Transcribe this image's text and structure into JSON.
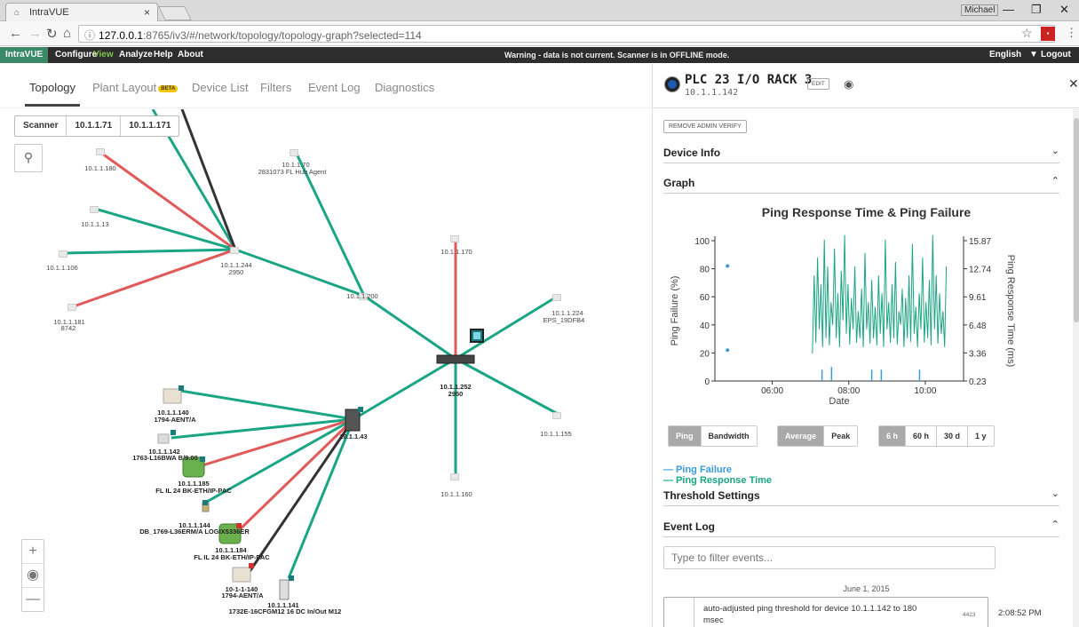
{
  "browser": {
    "tab_title": "IntraVUE",
    "url_host": "127.0.0.1",
    "url_rest": ":8765/iv3/#/network/topology/topology-graph?selected=114",
    "user": "Michael"
  },
  "appbar": {
    "brand": "IntraVUE",
    "menu": [
      "Configure",
      "View",
      "Analyze",
      "Help",
      "About"
    ],
    "warning": "Warning - data is not current. Scanner is in OFFLINE mode.",
    "language": "English",
    "logout": "Logout"
  },
  "tabs": {
    "topology": "Topology",
    "plant_layout": "Plant Layout",
    "beta": "BETA",
    "device_list": "Device List",
    "filters": "Filters",
    "event_log": "Event Log",
    "diagnostics": "Diagnostics"
  },
  "scanner": {
    "label": "Scanner",
    "ip1": "10.1.1.71",
    "ip2": "10.1.1.171"
  },
  "nodes": {
    "n180": "10.1.1.180",
    "n13": "10.1.1.13",
    "n106": "10.1.1.106",
    "n181a": "10.1.1.181",
    "n181b": "8742",
    "n244a": "10.1.1.244",
    "n244b": "2950",
    "n70a": "10.1.1.70",
    "n70b": "2831073 FL Hub Agent",
    "n200": "10.1.1.200",
    "n170": "10.1.1.170",
    "n224a": "10.1.1.224",
    "n224b": "EPS_19DFB4",
    "n252a": "10.1.1.252",
    "n252b": "2950",
    "n155": "10.1.1.155",
    "n160": "10.1.1.160",
    "n43": "10.1.1.43",
    "n140a": "10.1.1.140",
    "n140b": "1794-AENT/A",
    "n142a": "10.1.1.142",
    "n142b": "1763-L16BWA B/9.00",
    "n185a": "10.1.1.185",
    "n185b": "FL IL 24 BK-ETH/IP-PAC",
    "n144a": "10.1.1.144",
    "n144b": "DB_1769-L36ERM/A LOGIX5336ER",
    "n184a": "10.1.1.184",
    "n184b": "FL IL 24 BK-ETH/IP-PAC",
    "n1140a": "10-1-1-140",
    "n1140b": "1794-AENT/A",
    "n141a": "10.1.1.141",
    "n141b": "1732E-16CFGM12 16 DC In/Out M12"
  },
  "panel": {
    "title": "PLC 23 I/O RACK 3",
    "edit": "EDIT",
    "ip": "10.1.1.142",
    "remove_admin": "REMOVE ADMIN VERIFY",
    "device_info": "Device Info",
    "graph": "Graph",
    "threshold": "Threshold Settings",
    "event_log": "Event Log",
    "filter_placeholder": "Type to filter events...",
    "event_date": "June 1, 2015",
    "event_text": "auto-adjusted ping threshold for device 10.1.1.142 to 180 msec",
    "event_num": "4423",
    "event_time": "2:08:52 PM",
    "buttons": {
      "ping": "Ping",
      "bandwidth": "Bandwidth",
      "average": "Average",
      "peak": "Peak",
      "h6": "6 h",
      "h60": "60 h",
      "d30": "30 d",
      "y1": "1 y"
    },
    "legend_failure": "— Ping Failure",
    "legend_response": "— Ping Response Time"
  },
  "chart_data": {
    "type": "line",
    "title": "Ping Response Time & Ping Failure",
    "xlabel": "Date",
    "ylabel": "Ping Failure (%)",
    "y2label": "Ping Response Time (ms)",
    "x_ticks": [
      "06:00",
      "08:00",
      "10:00"
    ],
    "y_ticks": [
      0,
      20,
      40,
      60,
      80,
      100
    ],
    "y2_ticks": [
      0.23,
      3.36,
      6.48,
      9.61,
      12.74,
      15.87
    ],
    "ylim": [
      0,
      100
    ],
    "y2lim": [
      0.23,
      15.87
    ],
    "colors": {
      "failure": "#3a9ad9",
      "response": "#1aa584"
    },
    "series": [
      {
        "name": "Ping Failure",
        "points": [
          [
            4.83,
            82
          ],
          [
            4.83,
            22
          ]
        ],
        "spikes": [
          [
            7.3,
            8
          ],
          [
            7.55,
            10
          ],
          [
            8.6,
            8
          ],
          [
            8.85,
            8
          ],
          [
            9.85,
            8
          ]
        ]
      },
      {
        "name": "Ping Response Time",
        "x_start": 7.05,
        "x_end": 10.55,
        "values": [
          3.3,
          12,
          4.5,
          14,
          6,
          11,
          4,
          16,
          5,
          13,
          4.2,
          9,
          6.5,
          15,
          5,
          10,
          4,
          12.5,
          7,
          16.5,
          5.5,
          11,
          4.3,
          9.5,
          6,
          13,
          4.5,
          8,
          5,
          10.5,
          4,
          14.5,
          6,
          9,
          4.4,
          11.5,
          5,
          8.5,
          4.2,
          12,
          5.5,
          10,
          4,
          16,
          6,
          9,
          4.5,
          11,
          5,
          13.5,
          4.3,
          8,
          6.5,
          10.5,
          4,
          9.5,
          5,
          12,
          4.6,
          15.5,
          5.5,
          8.5,
          4,
          10,
          6,
          14,
          4.5,
          9,
          5,
          11.5,
          4.2,
          16.5,
          6,
          12,
          4.4,
          10,
          5.5,
          8,
          4,
          13
        ]
      }
    ]
  }
}
